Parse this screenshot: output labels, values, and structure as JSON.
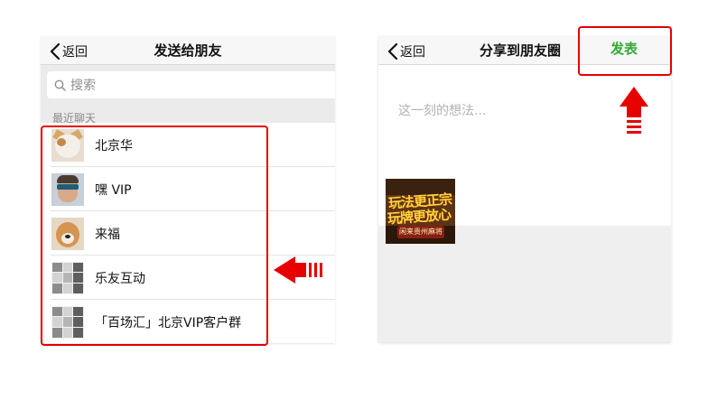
{
  "left_screen": {
    "back_label": "返回",
    "title": "发送给朋友",
    "search_placeholder": "搜索",
    "section_label": "最近聊天",
    "contacts": [
      {
        "name": "北京华",
        "avatar": "cat-photo"
      },
      {
        "name": "嘿 VIP",
        "avatar": "man-with-glasses-photo"
      },
      {
        "name": "来福",
        "avatar": "dog-photo"
      },
      {
        "name": "乐友互动",
        "avatar": "group-grid"
      },
      {
        "name": "「百场汇」北京VIP客户群",
        "avatar": "group-grid"
      }
    ]
  },
  "right_screen": {
    "back_label": "返回",
    "title": "分享到朋友圈",
    "publish_label": "发表",
    "compose_placeholder": "这一刻的想法...",
    "thumbnail_lines": [
      "玩法更正宗",
      "玩牌更放心",
      "闲来贵州麻将"
    ]
  },
  "annotations": {
    "highlight_color": "#e60000",
    "arrows": [
      "left-arrow-icon",
      "up-arrow-icon"
    ]
  },
  "colors": {
    "publish_green": "#33aa33",
    "nav_background": "#f7f7f7",
    "page_background": "#ebebeb"
  }
}
